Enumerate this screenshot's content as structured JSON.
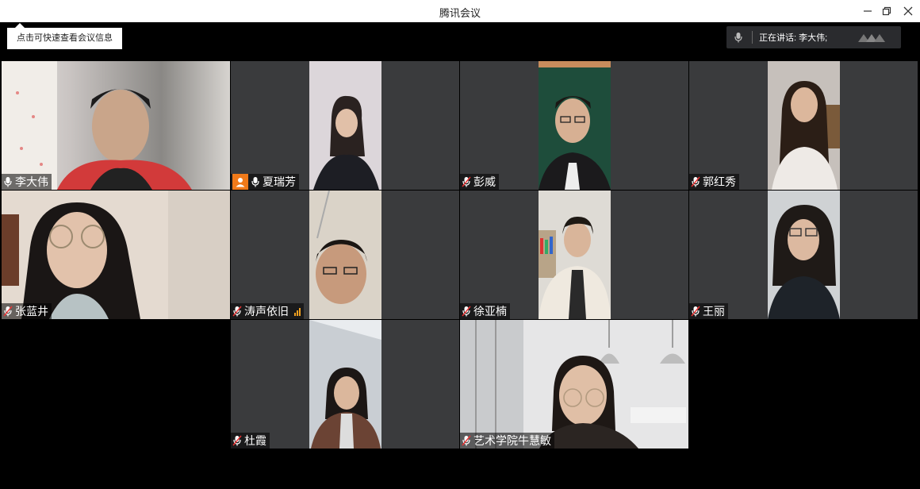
{
  "window": {
    "title": "腾讯会议"
  },
  "tooltip": {
    "text": "点击可快速查看会议信息"
  },
  "speaking": {
    "text": "正在讲话: 李大伟;"
  },
  "participants": [
    {
      "name": "李大伟"
    },
    {
      "name": "夏瑞芳"
    },
    {
      "name": "彭威"
    },
    {
      "name": "郭红秀"
    },
    {
      "name": "张蓝井"
    },
    {
      "name": "涛声依旧"
    },
    {
      "name": "徐亚楠"
    },
    {
      "name": "王丽"
    },
    {
      "name": "杜霞"
    },
    {
      "name": "艺术学院牛慧敏"
    }
  ],
  "colors": {
    "tile_bg": "#3a3b3d",
    "accent_orange": "#f07a1a",
    "signal": "#f0a020"
  },
  "icons": [
    "mic-icon",
    "user-icon",
    "minimize-icon",
    "restore-icon",
    "close-icon",
    "logo-icon"
  ]
}
